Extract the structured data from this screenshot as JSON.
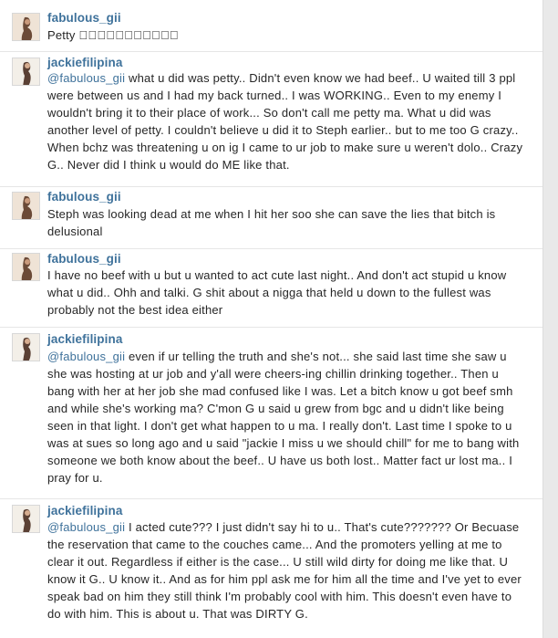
{
  "comments": [
    {
      "username": "fabulous_gii",
      "mention": "",
      "lines": [
        "Petty 󾌴󾌴󾌴󾌴󾌴󾌴󾌴󾌴󾌴󾌴󾌴"
      ]
    },
    {
      "username": "jackiefilipina",
      "mention": "@fabulous_gii",
      "lines": [
        " what u did was petty.. Didn't even know we had beef.. U waited till 3 ppl",
        "were between us and I had my back turned.. I was WORKING.. Even to my enemy I",
        "wouldn't bring it to their place of work... So don't call me petty ma. What u did was",
        "another level of petty. I couldn't believe u did it to Steph earlier.. but to me too G crazy..",
        "When bchz was threatening u on ig I came to ur job to make sure u weren't dolo.. Crazy",
        "G.. Never did I think u would do ME like that."
      ]
    },
    {
      "username": "fabulous_gii",
      "mention": "",
      "lines": [
        "Steph was looking dead at me when I hit her soo she can save the lies that bitch is",
        "delusional"
      ]
    },
    {
      "username": "fabulous_gii",
      "mention": "",
      "lines": [
        "I have no beef with u but u wanted to act cute last night.. And don't act stupid u know",
        "what u did.. Ohh and talki. G shit about a nigga that held u down to the fullest was",
        "probably not the best idea either"
      ]
    },
    {
      "username": "jackiefilipina",
      "mention": "@fabulous_gii",
      "lines": [
        " even if ur telling the truth and she's not... she said last time she saw u",
        "she was hosting at ur job and y'all were cheers-ing chillin drinking together.. Then u",
        "bang with her at her job she mad confused like I was. Let a bitch know u got beef smh",
        "and while she's working ma? C'mon G u said u grew from bgc and u didn't like being",
        "seen in that light. I don't get what happen to u ma. I really don't. Last time I spoke to u",
        "was at sues so long ago and u said \"jackie I miss u we should chill\" for me to bang with",
        "someone we both know about the beef.. U have us both lost.. Matter fact ur lost ma.. I",
        "pray for u."
      ]
    },
    {
      "username": "jackiefilipina",
      "mention": "@fabulous_gii",
      "lines": [
        " I acted cute??? I just didn't say hi to u.. That's cute??????? Or Becuase",
        "the reservation that came to the couches came... And the promoters yelling at me to",
        "clear it out. Regardless if either is the case... U still wild dirty for doing me like that. U",
        "know it G.. U know it.. And as for him ppl ask me for him all the time and I've yet to ever",
        "speak bad on him they still think I'm probably cool with him. This doesn't even have to",
        "do with him. This is about u. That was DIRTY G."
      ]
    }
  ]
}
